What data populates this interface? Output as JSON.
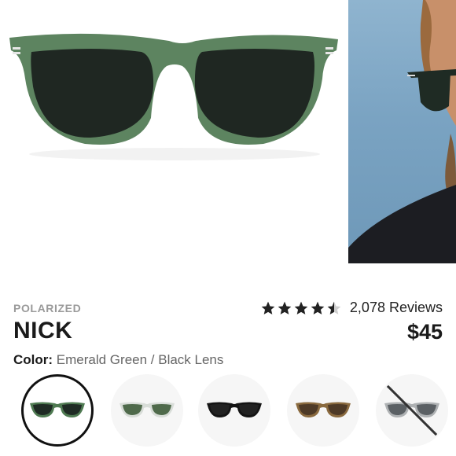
{
  "product": {
    "tag": "POLARIZED",
    "name": "NICK",
    "color_label": "Color:",
    "color_value": "Emerald Green / Black Lens",
    "rating": 4.5,
    "reviews": "2,078 Reviews",
    "price": "$45"
  },
  "hero": {
    "main_image": "emerald-green-sunglasses-front",
    "side_image": "model-wearing-sunglasses"
  },
  "swatches": [
    {
      "name": "Emerald Green / Black Lens",
      "frame": "#4f7a52",
      "lens": "#1f2b24",
      "selected": true,
      "available": true
    },
    {
      "name": "Clear / Green Lens",
      "frame": "#d8ddd8",
      "lens": "#4f6a4b",
      "selected": false,
      "available": true
    },
    {
      "name": "Black / Black Lens",
      "frame": "#141414",
      "lens": "#1a1a1a",
      "selected": false,
      "available": true
    },
    {
      "name": "Brown / Brown Lens",
      "frame": "#8a6a3f",
      "lens": "#4e3a27",
      "selected": false,
      "available": true
    },
    {
      "name": "Grey / Grey Lens",
      "frame": "#aeb1b3",
      "lens": "#5b6064",
      "selected": false,
      "available": false
    }
  ],
  "colors": {
    "text": "#1a1a1a",
    "muted": "#9a9a9a",
    "star": "#222222"
  }
}
